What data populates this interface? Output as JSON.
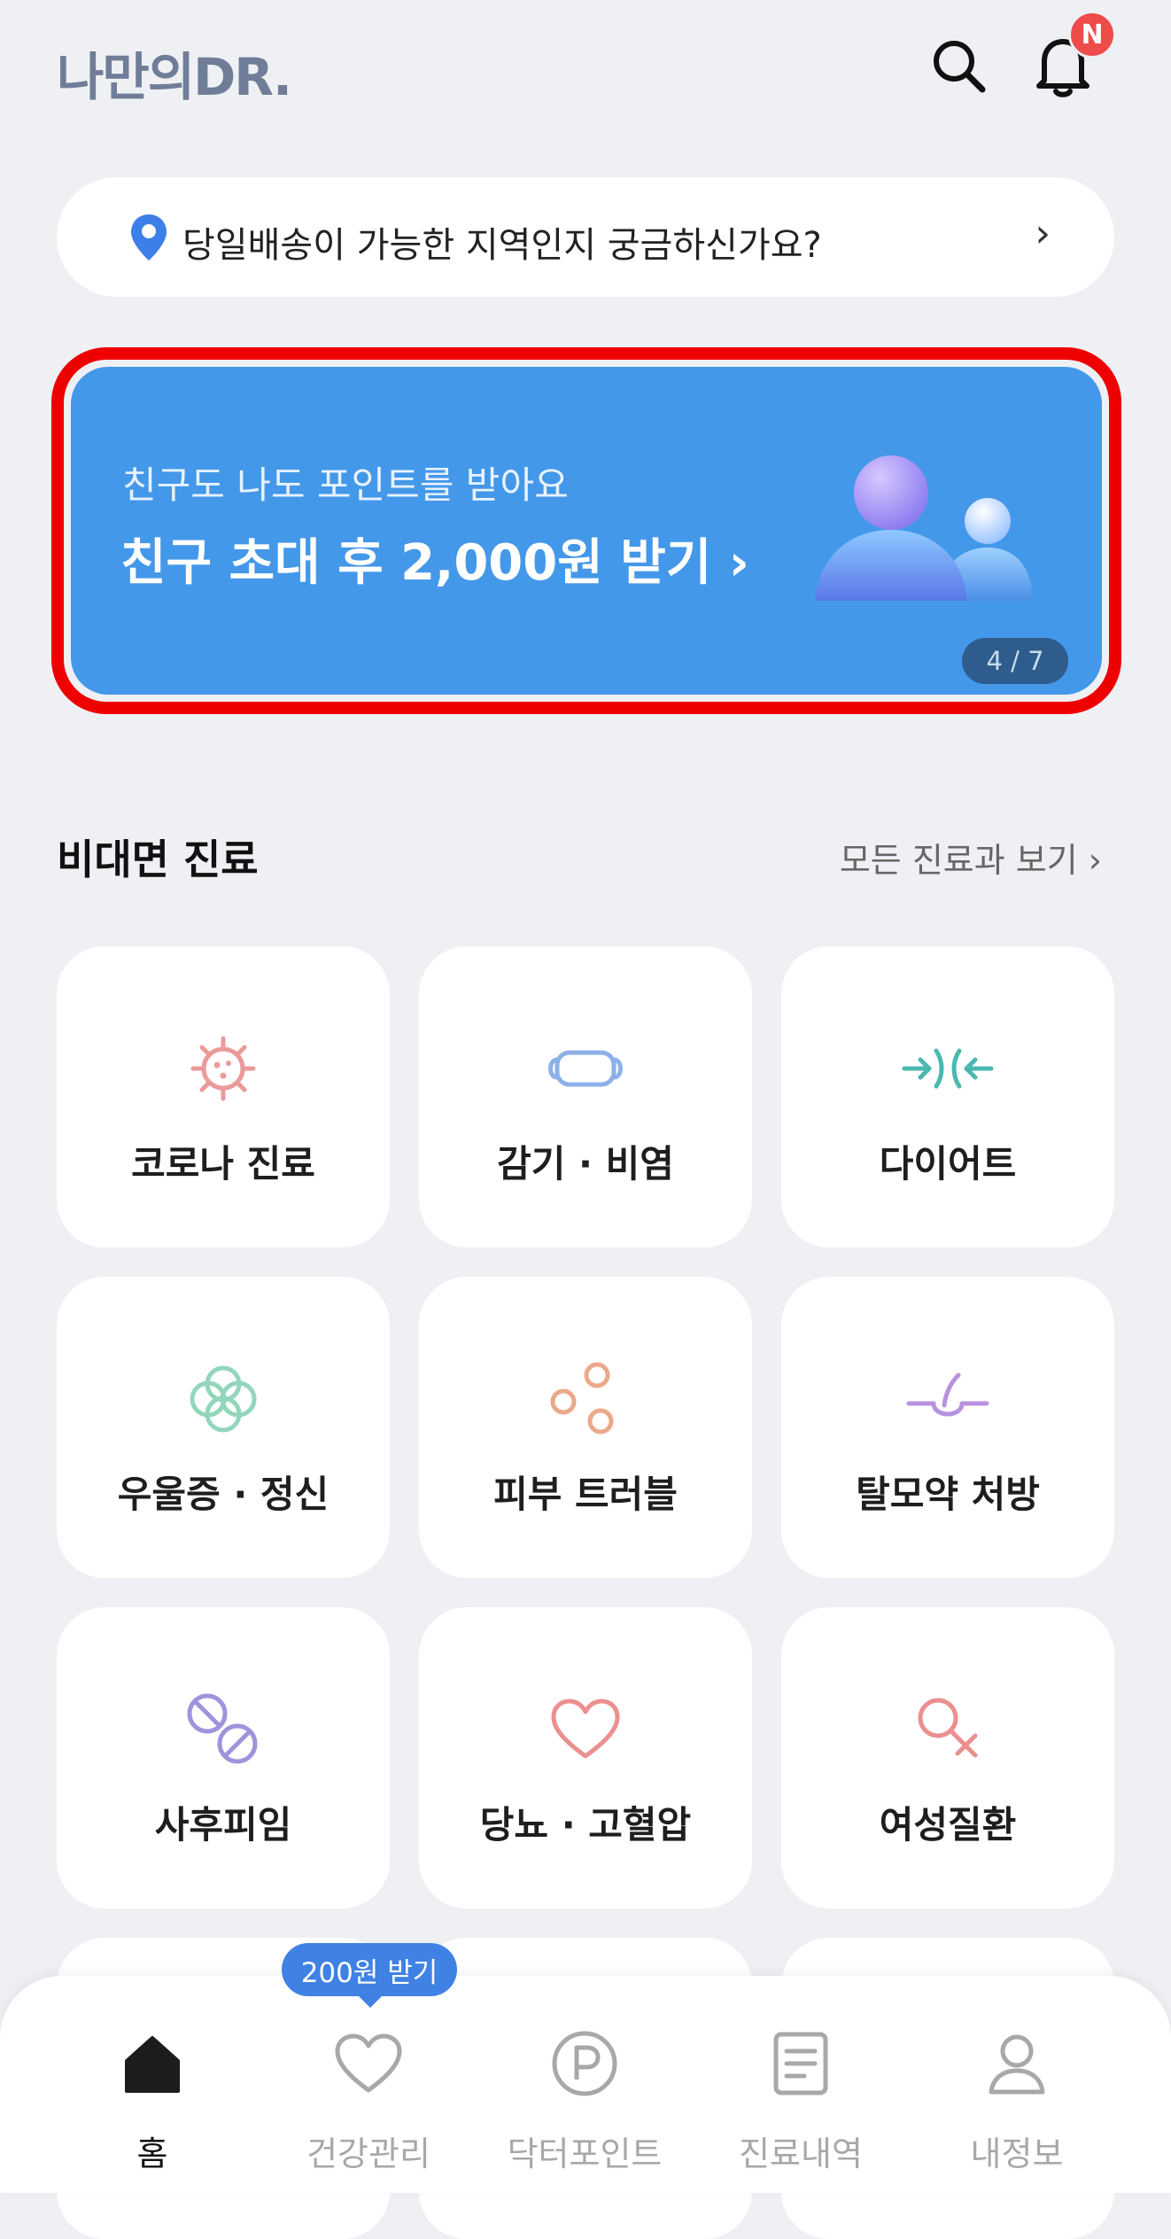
{
  "header": {
    "logo_text": "나만의DR.",
    "notification_badge": "N"
  },
  "delivery_banner": {
    "text": "당일배송이 가능한 지역인지 궁금하신가요?",
    "chevron": "›"
  },
  "promo_banner": {
    "subtitle": "친구도 나도 포인트를 받아요",
    "title": "친구 초대 후 2,000원 받기 ›",
    "page_indicator": "4 / 7",
    "background_color": "#4498e9",
    "highlight_color": "#ee0000"
  },
  "section": {
    "title": "비대면 진료",
    "link": "모든 진료과 보기 ›"
  },
  "departments": [
    {
      "label": "코로나 진료",
      "icon": "virus-icon"
    },
    {
      "label": "감기 · 비염",
      "icon": "mask-icon"
    },
    {
      "label": "다이어트",
      "icon": "diet-arrows-icon"
    },
    {
      "label": "우울증 · 정신",
      "icon": "flower-icon"
    },
    {
      "label": "피부 트러블",
      "icon": "skin-dots-icon"
    },
    {
      "label": "탈모약 처방",
      "icon": "hair-icon"
    },
    {
      "label": "사후피임",
      "icon": "pill-icon"
    },
    {
      "label": "당뇨 · 고혈압",
      "icon": "heart-icon"
    },
    {
      "label": "여성질환",
      "icon": "female-icon"
    }
  ],
  "bottom_nav": {
    "tooltip": "200원 받기",
    "items": [
      {
        "label": "홈",
        "icon": "home-icon",
        "active": true
      },
      {
        "label": "건강관리",
        "icon": "heart-outline-icon",
        "active": false
      },
      {
        "label": "닥터포인트",
        "icon": "point-icon",
        "active": false
      },
      {
        "label": "진료내역",
        "icon": "document-icon",
        "active": false
      },
      {
        "label": "내정보",
        "icon": "user-icon",
        "active": false
      }
    ]
  }
}
